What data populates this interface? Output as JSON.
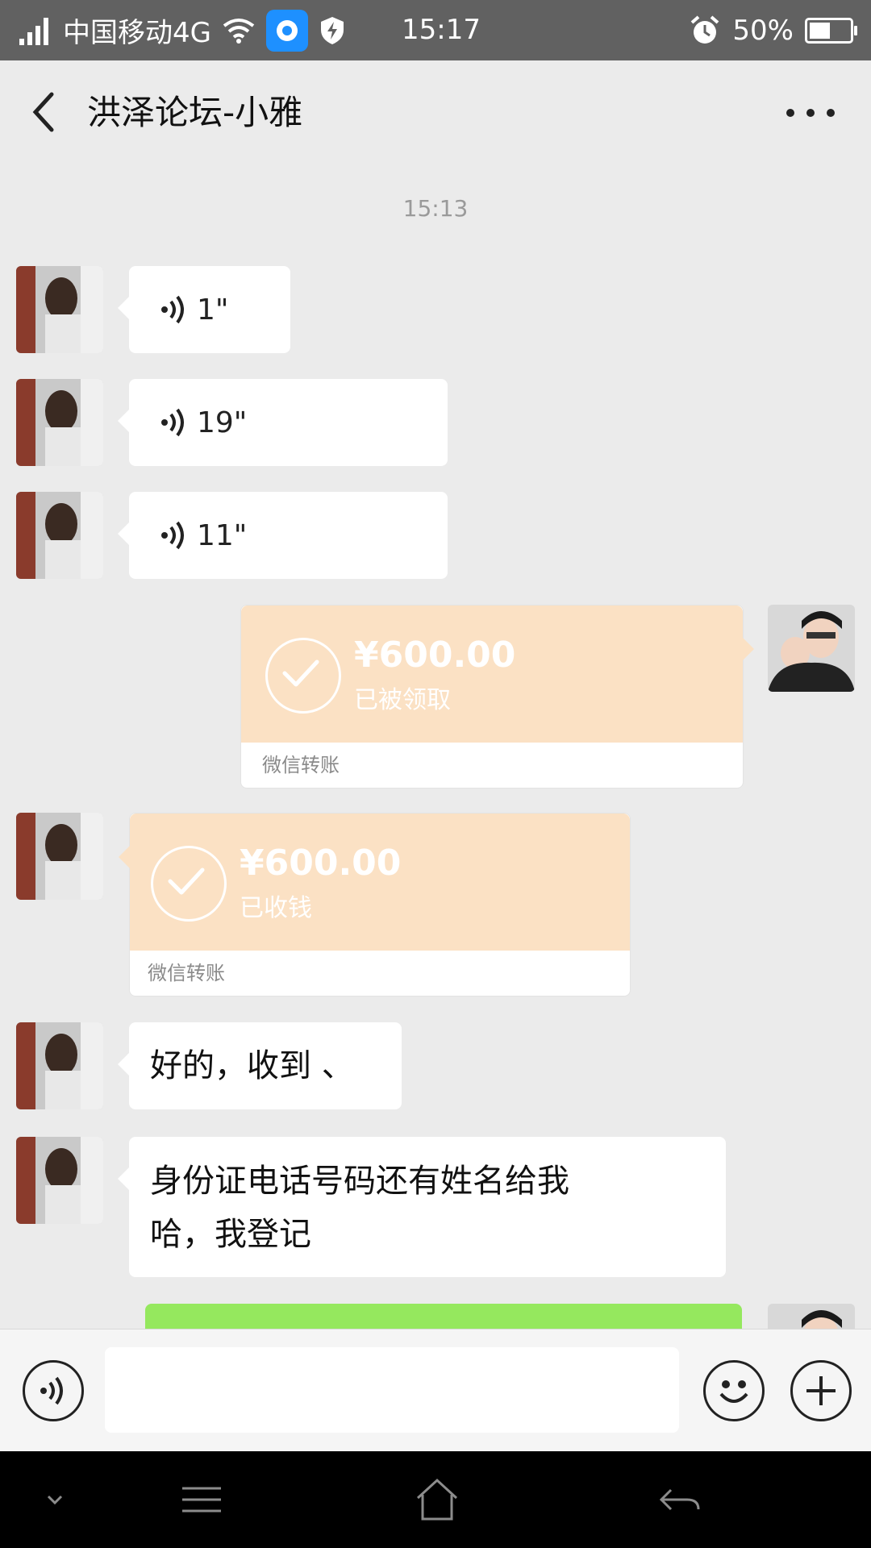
{
  "status_bar": {
    "carrier": "中国移动4G",
    "time": "15:17",
    "battery": "50%"
  },
  "header": {
    "title": "洪泽论坛-小雅"
  },
  "chat": {
    "timestamp": "15:13",
    "voice_messages": [
      {
        "duration": "1\""
      },
      {
        "duration": "19\""
      },
      {
        "duration": "11\""
      }
    ],
    "transfer_sent": {
      "amount": "¥600.00",
      "status": "已被领取",
      "label": "微信转账"
    },
    "transfer_received": {
      "amount": "¥600.00",
      "status": "已收钱",
      "label": "微信转账"
    },
    "text_1": "好的，收到 、",
    "text_2_line_1": "身份证电话号码还有姓名给我",
    "text_2_line_2": "哈，我登记"
  },
  "colors": {
    "transfer": "#fbe1c4",
    "outgoing": "#95e85e",
    "background": "#ebebeb"
  }
}
